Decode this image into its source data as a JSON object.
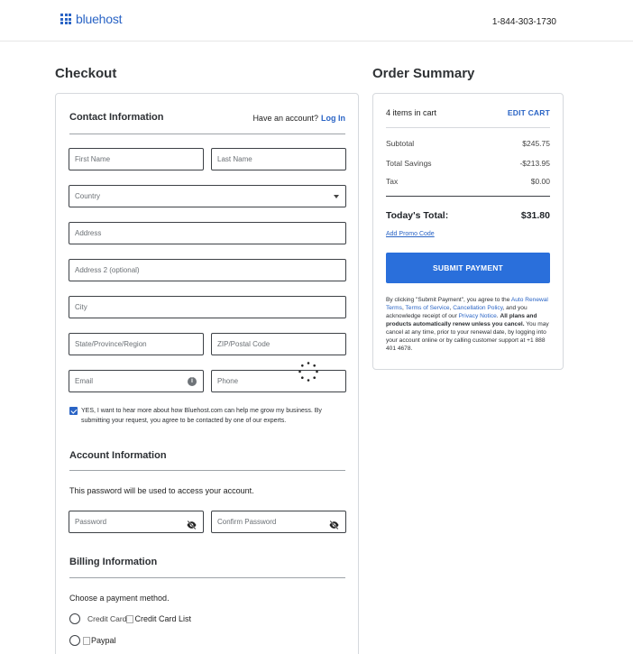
{
  "header": {
    "logo_text": "bluehost",
    "phone": "1-844-303-1730"
  },
  "checkout": {
    "title": "Checkout",
    "contact": {
      "title": "Contact Information",
      "have_account": "Have an account?",
      "login_link": "Log In",
      "first_name_placeholder": "First Name",
      "last_name_placeholder": "Last Name",
      "country_placeholder": "Country",
      "address_placeholder": "Address",
      "address2_placeholder": "Address 2 (optional)",
      "city_placeholder": "City",
      "state_placeholder": "State/Province/Region",
      "zip_placeholder": "ZIP/Postal Code",
      "email_placeholder": "Email",
      "phone_placeholder": "Phone",
      "marketing_opt_in_checked": true,
      "marketing_opt_in_text": "YES, I want to hear more about how Bluehost.com can help me grow my business. By submitting your request, you agree to be contacted by one of our experts."
    },
    "account": {
      "title": "Account Information",
      "note": "This password will be used to access your account.",
      "password_placeholder": "Password",
      "confirm_password_placeholder": "Confirm Password"
    },
    "billing": {
      "title": "Billing Information",
      "prompt": "Choose a payment method.",
      "methods": [
        {
          "label": "Credit Card",
          "image_alt": "Credit Card List"
        },
        {
          "label": "",
          "image_alt": "Paypal"
        }
      ]
    }
  },
  "summary": {
    "title": "Order Summary",
    "items_in_cart": "4 items in cart",
    "edit_cart": "EDIT CART",
    "rows": [
      {
        "label": "Subtotal",
        "value": "$245.75"
      },
      {
        "label": "Total Savings",
        "value": "-$213.95"
      },
      {
        "label": "Tax",
        "value": "$0.00"
      }
    ],
    "total_label": "Today's Total:",
    "total_value": "$31.80",
    "promo_link": "Add Promo Code",
    "submit_label": "SUBMIT PAYMENT",
    "legal": {
      "t1": "By clicking \"Submit Payment\", you agree to the ",
      "link1": "Auto Renewal Terms",
      "t2": ", ",
      "link2": "Terms of Service",
      "t3": ", ",
      "link3": "Cancellation Policy",
      "t4": ", and you acknowledge receipt of our ",
      "link4": "Privacy Notice",
      "t5": ". ",
      "bold": "All plans and products automatically renew unless you cancel.",
      "t6": " You may cancel at any time, prior to your renewal date, by logging into your account online or by calling customer support at +1 888 401 4678."
    }
  },
  "colors": {
    "brand_blue": "#2a64c5",
    "button_blue": "#2a6fdb"
  }
}
